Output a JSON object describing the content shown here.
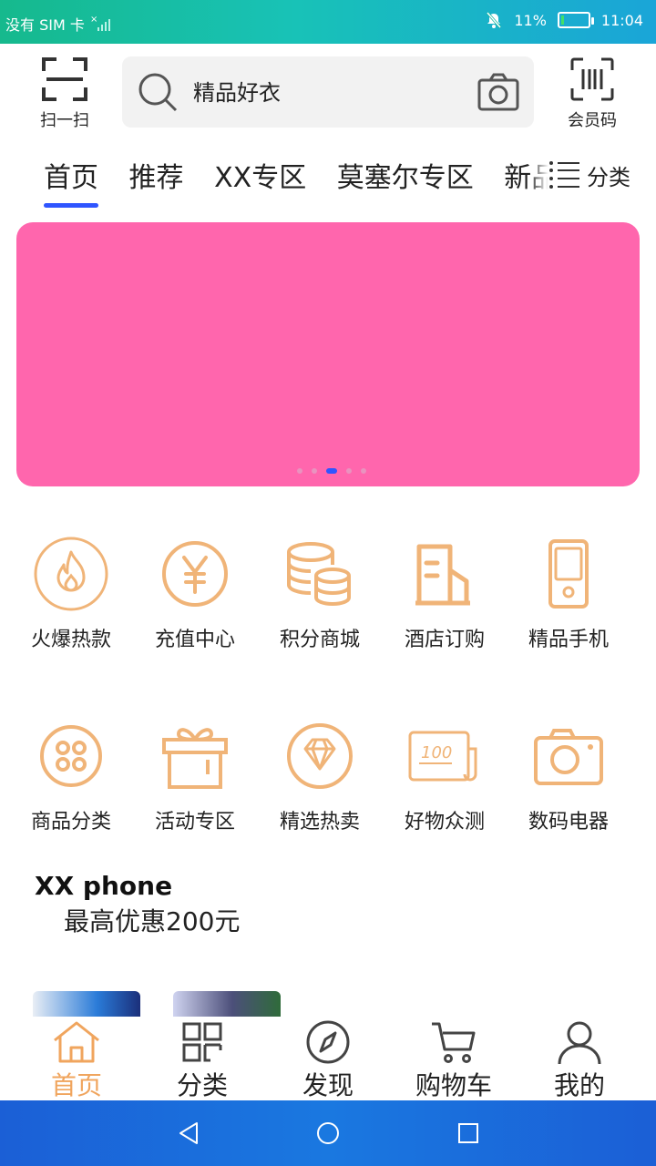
{
  "status_bar": {
    "carrier": "没有 SIM 卡",
    "battery_percent": "11%",
    "battery_level": 0.11,
    "time": "11:04"
  },
  "header": {
    "scan_label": "扫一扫",
    "search_text": "精品好衣",
    "member_label": "会员码"
  },
  "tabs": {
    "items": [
      "首页",
      "推荐",
      "XX专区",
      "莫塞尔专区",
      "新品"
    ],
    "active_index": 0,
    "category_label": "分类"
  },
  "banner": {
    "color": "#ff66ad",
    "page_count": 5,
    "active_page": 2
  },
  "grid": {
    "icon_color": "#f0b478",
    "items": [
      {
        "label": "火爆热款",
        "icon": "fire-icon"
      },
      {
        "label": "充值中心",
        "icon": "yen-icon"
      },
      {
        "label": "积分商城",
        "icon": "coins-icon"
      },
      {
        "label": "酒店订购",
        "icon": "building-icon"
      },
      {
        "label": "精品手机",
        "icon": "phone-icon"
      },
      {
        "label": "商品分类",
        "icon": "grid-dots-icon"
      },
      {
        "label": "活动专区",
        "icon": "gift-icon"
      },
      {
        "label": "精选热卖",
        "icon": "diamond-icon"
      },
      {
        "label": "好物众测",
        "icon": "ticket-icon"
      },
      {
        "label": "数码电器",
        "icon": "camera-icon"
      }
    ]
  },
  "promo": {
    "title": "XX phone",
    "subtitle": "最高优惠200元"
  },
  "bottom_nav": {
    "active_color": "#f0a55e",
    "items": [
      {
        "label": "首页",
        "icon": "home-icon"
      },
      {
        "label": "分类",
        "icon": "category-icon"
      },
      {
        "label": "发现",
        "icon": "compass-icon"
      },
      {
        "label": "购物车",
        "icon": "cart-icon"
      },
      {
        "label": "我的",
        "icon": "user-icon"
      }
    ],
    "active_index": 0
  }
}
